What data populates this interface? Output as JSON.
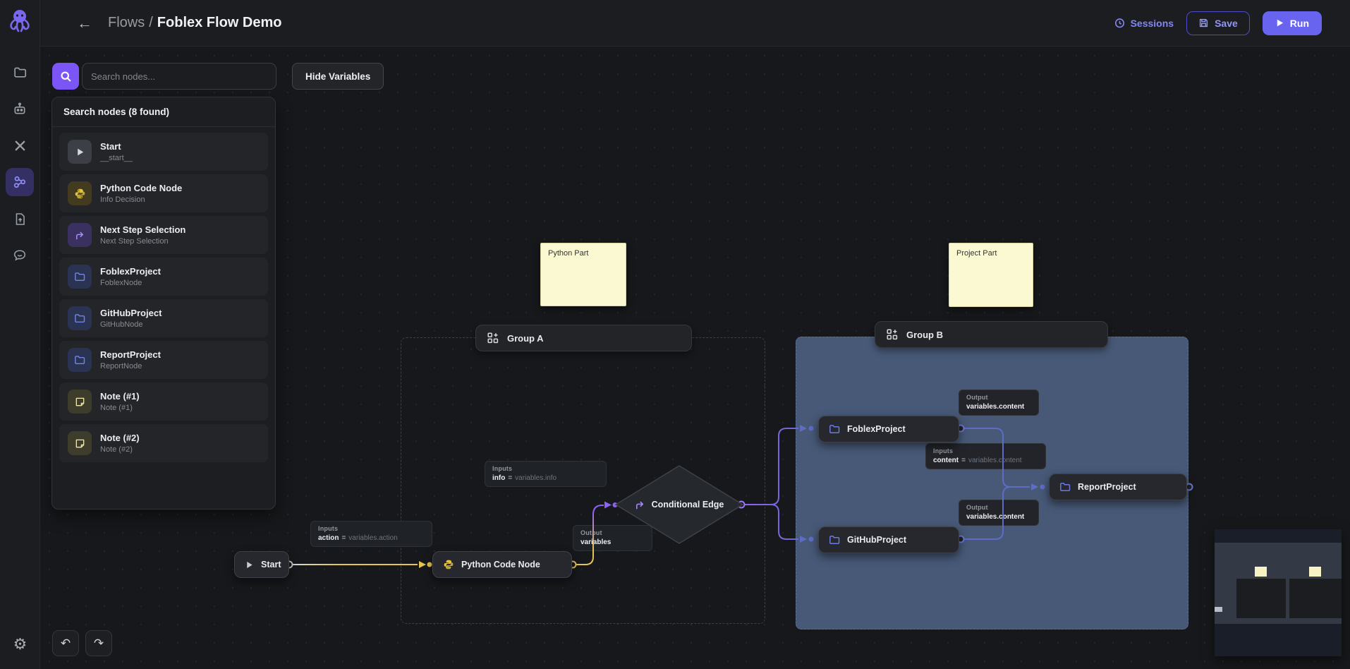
{
  "header": {
    "breadcrumb": {
      "section": "Flows",
      "separator": "/",
      "title": "Foblex Flow Demo"
    },
    "sessions_label": "Sessions",
    "save_label": "Save",
    "run_label": "Run"
  },
  "toolbar": {
    "search_placeholder": "Search nodes...",
    "hide_variables_label": "Hide Variables"
  },
  "search_panel": {
    "title": "Search nodes (8 found)",
    "results": [
      {
        "title": "Start",
        "subtitle": "__start__",
        "icon": "play-icon"
      },
      {
        "title": "Python Code Node",
        "subtitle": "Info Decision",
        "icon": "python-icon"
      },
      {
        "title": "Next Step Selection",
        "subtitle": "Next Step Selection",
        "icon": "branch-icon"
      },
      {
        "title": "FoblexProject",
        "subtitle": "FoblexNode",
        "icon": "folder-icon"
      },
      {
        "title": "GitHubProject",
        "subtitle": "GitHubNode",
        "icon": "folder-icon"
      },
      {
        "title": "ReportProject",
        "subtitle": "ReportNode",
        "icon": "folder-icon"
      },
      {
        "title": "Note (#1)",
        "subtitle": "Note (#1)",
        "icon": "note-icon"
      },
      {
        "title": "Note (#2)",
        "subtitle": "Note (#2)",
        "icon": "note-icon"
      }
    ]
  },
  "canvas": {
    "notes": [
      {
        "text": "Python Part"
      },
      {
        "text": "Project Part"
      }
    ],
    "groups": [
      {
        "label": "Group A"
      },
      {
        "label": "Group B"
      }
    ],
    "nodes": [
      {
        "label": "Start"
      },
      {
        "label": "Python Code Node"
      },
      {
        "label": "Conditional Edge"
      },
      {
        "label": "FoblexProject"
      },
      {
        "label": "GitHubProject"
      },
      {
        "label": "ReportProject"
      }
    ],
    "io_panels": [
      {
        "header": "Inputs",
        "key": "action",
        "eq": "=",
        "value": "variables.action"
      },
      {
        "header": "Inputs",
        "key": "info",
        "eq": "=",
        "value": "variables.info"
      },
      {
        "header": "Output",
        "key": "variables"
      },
      {
        "header": "Output",
        "key": "variables.content"
      },
      {
        "header": "Inputs",
        "key": "content",
        "eq": "=",
        "value": "variables.content"
      },
      {
        "header": "Output",
        "key": "variables.content"
      }
    ]
  },
  "icons": {
    "back": "←",
    "undo": "↶",
    "redo": "↷",
    "gear": "⚙"
  },
  "colors": {
    "accent": "#7c55f6",
    "run_button": "#6964ef",
    "edge_yellow": "#e3c552",
    "edge_purple": "#8e63f3",
    "edge_blue": "#5f6cc6",
    "group_b_fill": "#475977",
    "note_fill": "#fbf9d2"
  }
}
